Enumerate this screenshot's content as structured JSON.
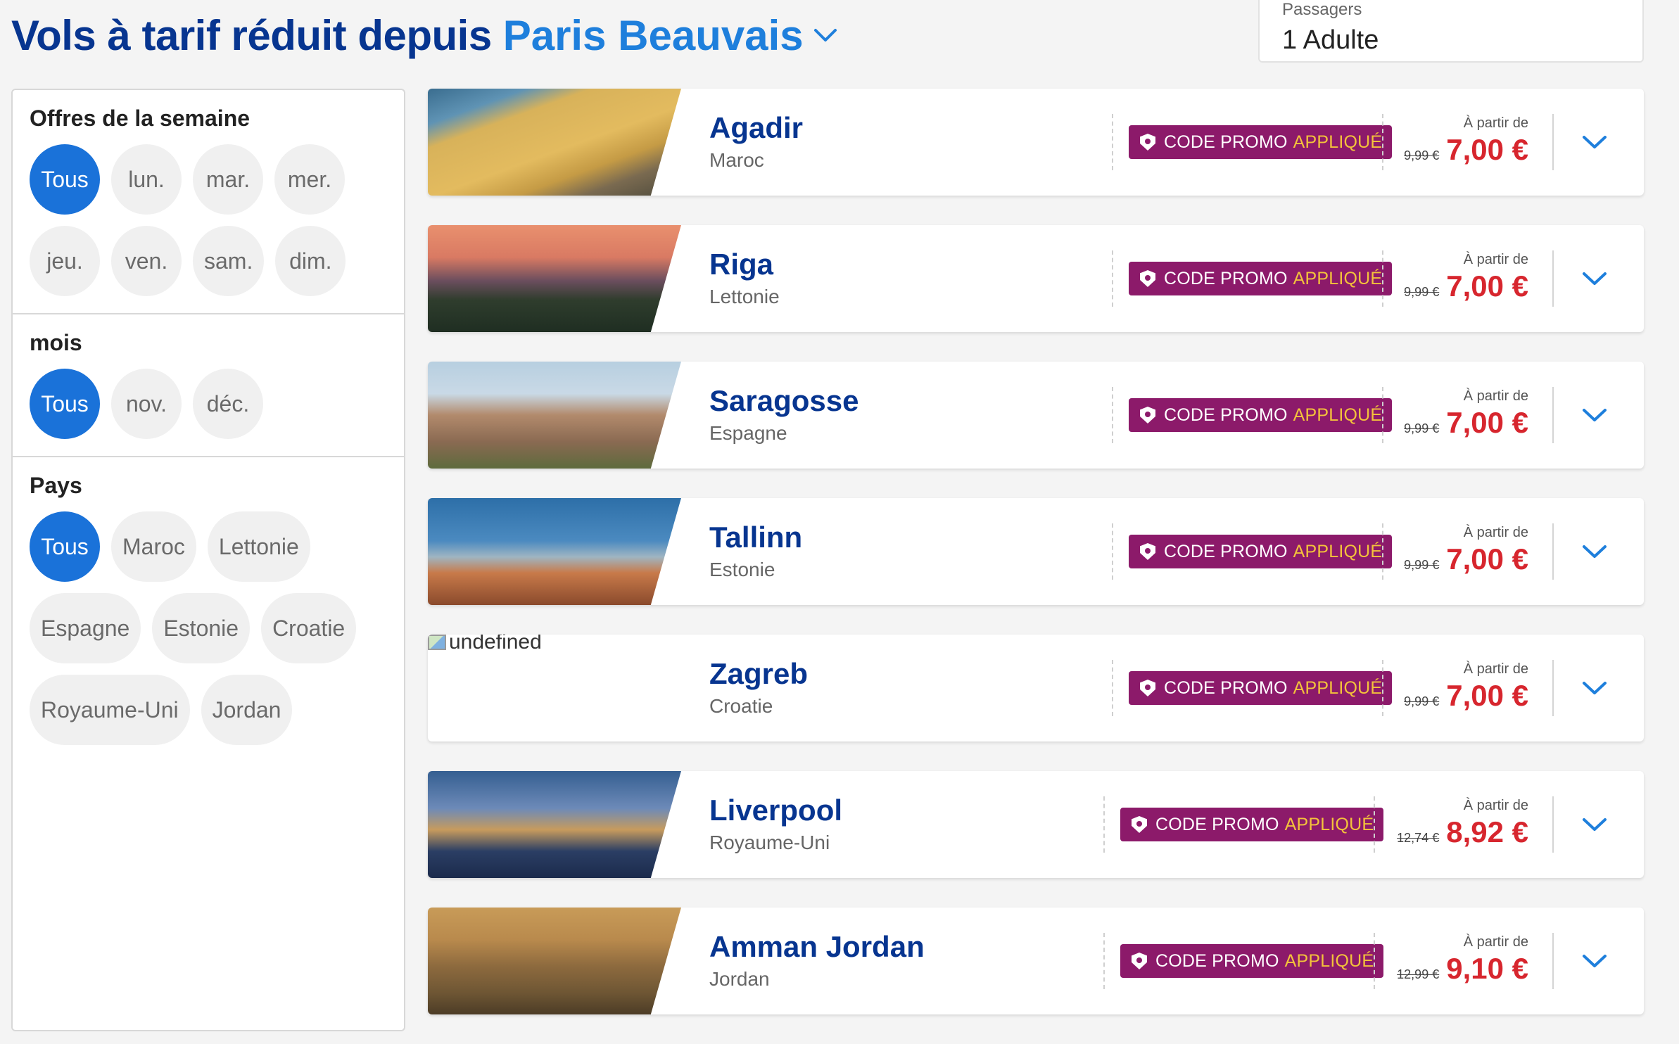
{
  "header": {
    "title": "Vols à tarif réduit depuis",
    "origin": "Paris Beauvais",
    "origin_icon": "chevron-down-icon"
  },
  "passengers": {
    "label": "Passagers",
    "value": "1 Adulte"
  },
  "filters": {
    "week": {
      "title": "Offres de la semaine",
      "chips": [
        "Tous",
        "lun.",
        "mar.",
        "mer.",
        "jeu.",
        "ven.",
        "sam.",
        "dim."
      ],
      "selected": "Tous"
    },
    "month": {
      "title": "mois",
      "chips": [
        "Tous",
        "nov.",
        "déc."
      ],
      "selected": "Tous"
    },
    "country": {
      "title": "Pays",
      "chips": [
        "Tous",
        "Maroc",
        "Lettonie",
        "Espagne",
        "Estonie",
        "Croatie",
        "Royaume-Uni",
        "Jordan"
      ],
      "selected": "Tous"
    }
  },
  "colors": {
    "brand_dark": "#073590",
    "brand_blue": "#1e7fdc",
    "chip_active": "#1a72d9",
    "promo_bg": "#8c1a6a",
    "promo_accent": "#f3c23b",
    "price_red": "#d7262e"
  },
  "results": [
    {
      "city": "Agadir",
      "country": "Maroc",
      "promo": "CODE PROMO",
      "promo_applied": "APPLIQUÉ",
      "from_label": "À partir de",
      "old_price": "9,99 €",
      "price": "7,00 €",
      "image": "beach"
    },
    {
      "city": "Riga",
      "country": "Lettonie",
      "promo": "CODE PROMO",
      "promo_applied": "APPLIQUÉ",
      "from_label": "À partir de",
      "old_price": "9,99 €",
      "price": "7,00 €",
      "image": "old-town-dusk"
    },
    {
      "city": "Saragosse",
      "country": "Espagne",
      "promo": "CODE PROMO",
      "promo_applied": "APPLIQUÉ",
      "from_label": "À partir de",
      "old_price": "9,99 €",
      "price": "7,00 €",
      "image": "basilica"
    },
    {
      "city": "Tallinn",
      "country": "Estonie",
      "promo": "CODE PROMO",
      "promo_applied": "APPLIQUÉ",
      "from_label": "À partir de",
      "old_price": "9,99 €",
      "price": "7,00 €",
      "image": "towers-sea"
    },
    {
      "city": "Zagreb",
      "country": "Croatie",
      "promo": "CODE PROMO",
      "promo_applied": "APPLIQUÉ",
      "from_label": "À partir de",
      "old_price": "9,99 €",
      "price": "7,00 €",
      "image": "broken",
      "image_alt": "undefined"
    },
    {
      "city": "Liverpool",
      "country": "Royaume-Uni",
      "promo": "CODE PROMO",
      "promo_applied": "APPLIQUÉ",
      "from_label": "À partir de",
      "old_price": "12,74 €",
      "price": "8,92 €",
      "image": "waterfront"
    },
    {
      "city": "Amman Jordan",
      "country": "Jordan",
      "promo": "CODE PROMO",
      "promo_applied": "APPLIQUÉ",
      "from_label": "À partir de",
      "old_price": "12,99 €",
      "price": "9,10 €",
      "image": "ruins"
    }
  ]
}
